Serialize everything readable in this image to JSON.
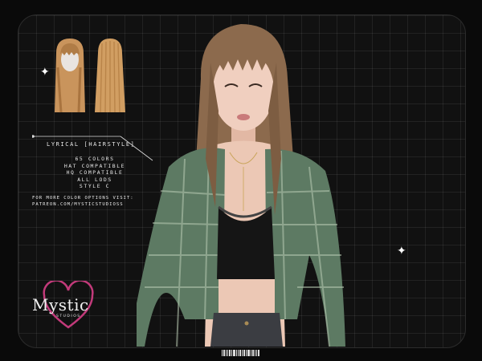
{
  "product": {
    "title": "LYRICAL [HAIRSTYLE]",
    "specs": [
      "65 COLORS",
      "HAT COMPATIBLE",
      "HQ COMPATIBLE",
      "ALL LODS",
      "STYLE C"
    ],
    "more_line1": "FOR MORE COLOR OPTIONS VISIT:",
    "more_line2": "PATREON.COM/MYSTICSTUDIOSS"
  },
  "brand": {
    "name": "Mystic",
    "sub": "STUDIOS"
  },
  "colors": {
    "hair": "#b58a5e",
    "top_green": "#5d7a63",
    "cami": "#151515",
    "skin": "#e8c3b0",
    "logo_heart": "#c23a7a"
  },
  "icons": [
    "sparkle-icon",
    "heart-logo-icon",
    "barcode-icon"
  ]
}
